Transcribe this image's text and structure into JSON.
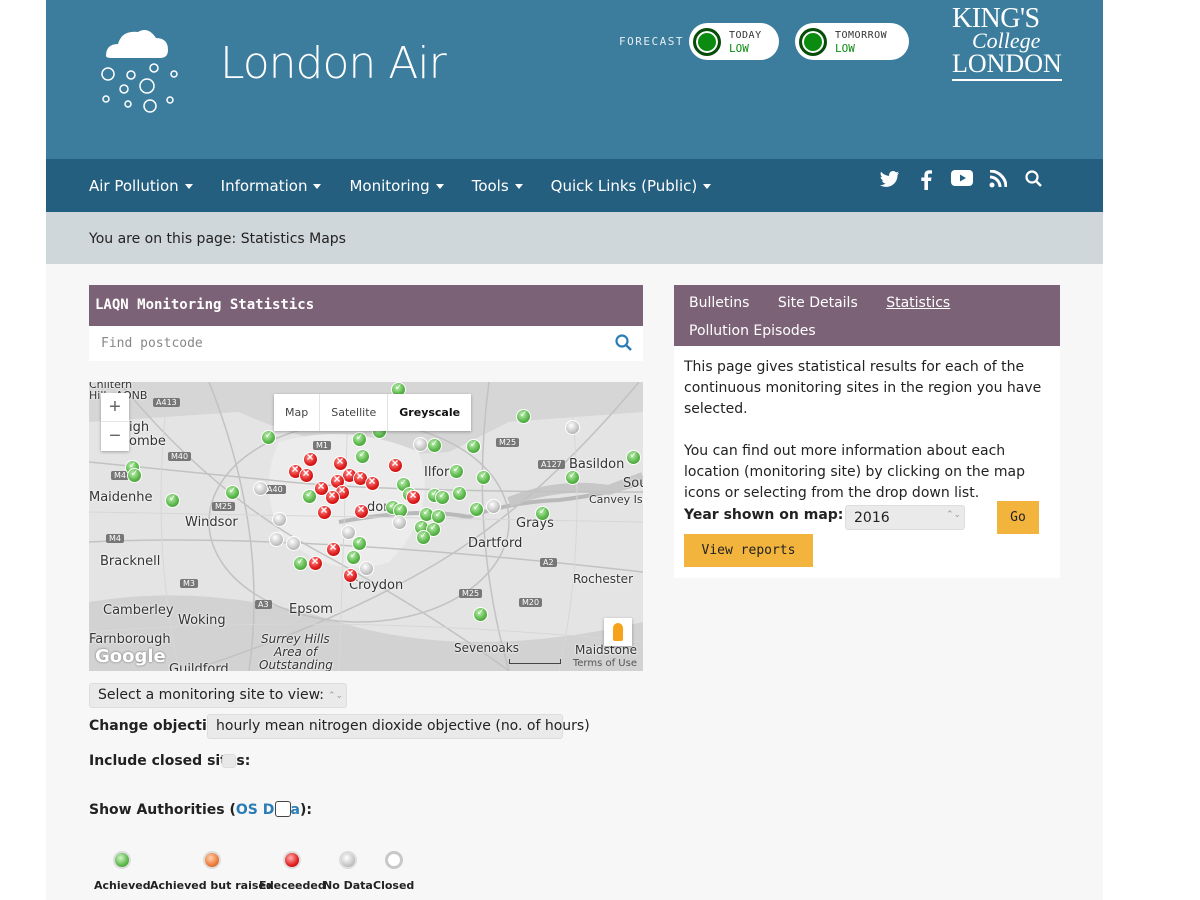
{
  "header": {
    "logo_text": "London Air",
    "forecast_label": "FORECAST",
    "today": {
      "day": "TODAY",
      "level": "LOW"
    },
    "tomorrow": {
      "day": "TOMORROW",
      "level": "LOW"
    },
    "kcl": {
      "line1": "KING'S",
      "line2": "College",
      "line3": "LONDON"
    }
  },
  "nav": {
    "items": [
      "Air Pollution",
      "Information",
      "Monitoring",
      "Tools",
      "Quick Links (Public)"
    ]
  },
  "breadcrumb": "You are on this page: Statistics Maps",
  "left": {
    "title": "LAQN Monitoring Statistics",
    "search_placeholder": "Find postcode",
    "map_tabs": [
      "Map",
      "Satellite",
      "Greyscale"
    ],
    "map_labels": {
      "chiltern": "Chiltern",
      "hills": "Hills AONB",
      "igh": "igh",
      "combe": "ombe",
      "maidenhead": "Maidenhe",
      "windsor": "Windsor",
      "bracknell": "Bracknell",
      "camberley": "Camberley",
      "woking": "Woking",
      "farnborough": "Farnborough",
      "guildford": "Guildford",
      "epsom": "Epsom",
      "surrey": "Surrey Hills",
      "aonb_area": "Area of",
      "outstanding": "Outstanding",
      "croydon": "Croydon",
      "dartford": "Dartford",
      "grays": "Grays",
      "basildon": "Basildon",
      "canvey": "Canvey Isle",
      "son": "Sou",
      "rochester": "Rochester",
      "sevenoaks": "Sevenoaks",
      "maidstone": "Maidstone",
      "ilford": "Ilford",
      "london": "don"
    },
    "google": "Google",
    "terms": "Terms of Use",
    "site_select": "Select a monitoring site to view:",
    "objective_label": "Change objective:",
    "objective_value": "hourly mean nitrogen dioxide objective (no. of hours)",
    "closed_label": "Include closed sites:",
    "authorities_prefix": "Show Authorities (",
    "authorities_link": "OS Data",
    "authorities_suffix": "):",
    "legend": [
      "Achieved",
      "Achieved but raised",
      "Execeeded",
      "No Data",
      "Closed"
    ]
  },
  "right": {
    "tabs": [
      "Bulletins",
      "Site Details",
      "Statistics",
      "Pollution Episodes"
    ],
    "para1": "This page gives statistical results for each of the continuous monitoring sites in the region you have selected.",
    "para2": "You can find out more information about each location (monitoring site) by clicking on the map icons or selecting from the drop down list.",
    "year_label": "Year shown on map:",
    "year_value": "2016",
    "go": "Go",
    "view_reports": "View reports"
  },
  "colors": {
    "header": "#3c7d9e",
    "nav": "#245f80",
    "panel": "#7c6276",
    "button": "#f2b43c",
    "link": "#2a7db5"
  }
}
